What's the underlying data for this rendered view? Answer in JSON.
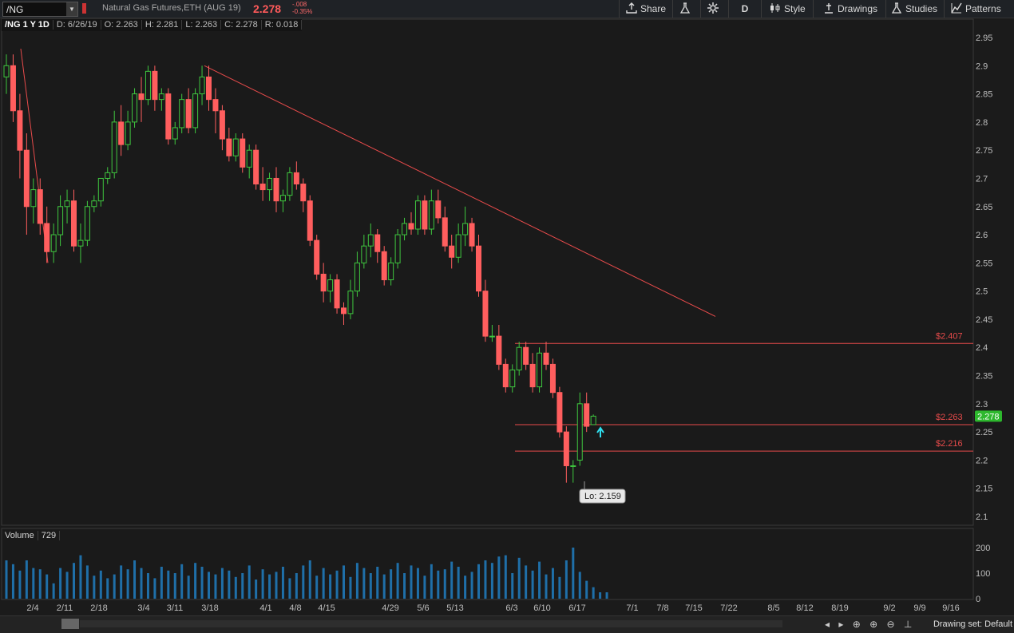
{
  "toolbar": {
    "symbol": "/NG",
    "description": "Natural Gas Futures,ETH (AUG 19)",
    "last_price": "2.278",
    "change": "-.008",
    "change_pct": "-0.35%",
    "share_label": "Share",
    "period_label": "D",
    "style_label": "Style",
    "drawings_label": "Drawings",
    "studies_label": "Studies",
    "patterns_label": "Patterns"
  },
  "info": {
    "symbol_period": "/NG 1 Y 1D",
    "date": "D: 6/26/19",
    "open": "O: 2.263",
    "high": "H: 2.281",
    "low": "L: 2.263",
    "close": "C: 2.278",
    "range": "R: 0.018"
  },
  "volume_panel": {
    "label": "Volume",
    "value": "729"
  },
  "price_lines": [
    {
      "label": "$2.407",
      "price": 2.407
    },
    {
      "label": "$2.263",
      "price": 2.263
    },
    {
      "label": "$2.216",
      "price": 2.216
    }
  ],
  "current_price_badge": "2.278",
  "low_callout": "Lo: 2.159",
  "bottom": {
    "drawing_set": "Drawing set: Default"
  },
  "colors": {
    "up": "#3fc73f",
    "down": "#ff5e5e",
    "volume": "#1f6fa8",
    "trendline": "#e84b4b",
    "badge": "#2db82d"
  },
  "chart_data": {
    "type": "candlestick",
    "price_axis": {
      "min": 2.1,
      "max": 2.95,
      "ticks": [
        2.95,
        2.9,
        2.85,
        2.8,
        2.75,
        2.7,
        2.65,
        2.6,
        2.55,
        2.5,
        2.45,
        2.4,
        2.35,
        2.3,
        2.25,
        2.2,
        2.15,
        2.1
      ]
    },
    "volume_axis": {
      "max": 200,
      "ticks": [
        200,
        100,
        0
      ]
    },
    "x_tick_labels": [
      "2/4",
      "2/11",
      "2/18",
      "3/4",
      "3/11",
      "3/18",
      "4/1",
      "4/8",
      "4/15",
      "4/29",
      "5/6",
      "5/13",
      "6/3",
      "6/10",
      "6/17",
      "7/1",
      "7/8",
      "7/15",
      "7/22",
      "8/5",
      "8/12",
      "8/19",
      "9/2",
      "9/9",
      "9/16"
    ],
    "trendlines": [
      {
        "from": [
          "start",
          2.93
        ],
        "to": [
          "2/11",
          2.55
        ]
      },
      {
        "from": [
          "3/18",
          2.9
        ],
        "to": [
          "7/22",
          2.455
        ]
      }
    ],
    "candles": [
      [
        2.88,
        2.92,
        2.85,
        2.9
      ],
      [
        2.9,
        2.92,
        2.8,
        2.82
      ],
      [
        2.82,
        2.85,
        2.7,
        2.75
      ],
      [
        2.75,
        2.78,
        2.6,
        2.65
      ],
      [
        2.65,
        2.7,
        2.62,
        2.68
      ],
      [
        2.68,
        2.7,
        2.6,
        2.62
      ],
      [
        2.62,
        2.65,
        2.55,
        2.57
      ],
      [
        2.57,
        2.62,
        2.55,
        2.6
      ],
      [
        2.6,
        2.67,
        2.58,
        2.65
      ],
      [
        2.65,
        2.68,
        2.62,
        2.66
      ],
      [
        2.66,
        2.68,
        2.57,
        2.58
      ],
      [
        2.58,
        2.62,
        2.55,
        2.59
      ],
      [
        2.59,
        2.66,
        2.58,
        2.65
      ],
      [
        2.65,
        2.67,
        2.64,
        2.66
      ],
      [
        2.66,
        2.7,
        2.65,
        2.7
      ],
      [
        2.7,
        2.72,
        2.69,
        2.71
      ],
      [
        2.71,
        2.82,
        2.7,
        2.8
      ],
      [
        2.8,
        2.83,
        2.74,
        2.76
      ],
      [
        2.76,
        2.82,
        2.75,
        2.8
      ],
      [
        2.8,
        2.86,
        2.79,
        2.85
      ],
      [
        2.85,
        2.88,
        2.8,
        2.84
      ],
      [
        2.84,
        2.9,
        2.83,
        2.89
      ],
      [
        2.89,
        2.9,
        2.82,
        2.84
      ],
      [
        2.84,
        2.86,
        2.82,
        2.85
      ],
      [
        2.85,
        2.86,
        2.76,
        2.77
      ],
      [
        2.77,
        2.8,
        2.76,
        2.79
      ],
      [
        2.79,
        2.85,
        2.78,
        2.84
      ],
      [
        2.84,
        2.86,
        2.78,
        2.79
      ],
      [
        2.79,
        2.86,
        2.78,
        2.85
      ],
      [
        2.85,
        2.9,
        2.83,
        2.88
      ],
      [
        2.88,
        2.9,
        2.82,
        2.84
      ],
      [
        2.84,
        2.86,
        2.78,
        2.82
      ],
      [
        2.82,
        2.83,
        2.75,
        2.77
      ],
      [
        2.77,
        2.79,
        2.73,
        2.74
      ],
      [
        2.74,
        2.78,
        2.73,
        2.77
      ],
      [
        2.77,
        2.78,
        2.71,
        2.72
      ],
      [
        2.72,
        2.76,
        2.7,
        2.75
      ],
      [
        2.75,
        2.76,
        2.68,
        2.69
      ],
      [
        2.69,
        2.72,
        2.66,
        2.68
      ],
      [
        2.68,
        2.71,
        2.66,
        2.7
      ],
      [
        2.7,
        2.72,
        2.64,
        2.66
      ],
      [
        2.66,
        2.68,
        2.64,
        2.67
      ],
      [
        2.67,
        2.72,
        2.66,
        2.71
      ],
      [
        2.71,
        2.73,
        2.68,
        2.69
      ],
      [
        2.69,
        2.7,
        2.64,
        2.66
      ],
      [
        2.66,
        2.67,
        2.58,
        2.59
      ],
      [
        2.59,
        2.6,
        2.52,
        2.53
      ],
      [
        2.53,
        2.55,
        2.48,
        2.5
      ],
      [
        2.5,
        2.53,
        2.48,
        2.52
      ],
      [
        2.52,
        2.53,
        2.46,
        2.47
      ],
      [
        2.47,
        2.48,
        2.44,
        2.46
      ],
      [
        2.46,
        2.52,
        2.45,
        2.5
      ],
      [
        2.5,
        2.57,
        2.49,
        2.55
      ],
      [
        2.55,
        2.6,
        2.54,
        2.58
      ],
      [
        2.58,
        2.62,
        2.56,
        2.6
      ],
      [
        2.6,
        2.61,
        2.55,
        2.57
      ],
      [
        2.57,
        2.58,
        2.51,
        2.52
      ],
      [
        2.52,
        2.56,
        2.51,
        2.55
      ],
      [
        2.55,
        2.61,
        2.54,
        2.6
      ],
      [
        2.6,
        2.63,
        2.59,
        2.62
      ],
      [
        2.62,
        2.64,
        2.6,
        2.61
      ],
      [
        2.61,
        2.67,
        2.6,
        2.66
      ],
      [
        2.66,
        2.67,
        2.6,
        2.61
      ],
      [
        2.61,
        2.68,
        2.6,
        2.66
      ],
      [
        2.66,
        2.68,
        2.62,
        2.63
      ],
      [
        2.63,
        2.65,
        2.57,
        2.58
      ],
      [
        2.58,
        2.6,
        2.54,
        2.56
      ],
      [
        2.56,
        2.62,
        2.55,
        2.6
      ],
      [
        2.6,
        2.65,
        2.58,
        2.62
      ],
      [
        2.62,
        2.63,
        2.57,
        2.58
      ],
      [
        2.58,
        2.6,
        2.49,
        2.5
      ],
      [
        2.5,
        2.52,
        2.41,
        2.42
      ],
      [
        2.42,
        2.44,
        2.41,
        2.42
      ],
      [
        2.42,
        2.44,
        2.36,
        2.37
      ],
      [
        2.37,
        2.38,
        2.32,
        2.33
      ],
      [
        2.33,
        2.37,
        2.32,
        2.36
      ],
      [
        2.36,
        2.41,
        2.35,
        2.4
      ],
      [
        2.4,
        2.41,
        2.36,
        2.37
      ],
      [
        2.37,
        2.39,
        2.32,
        2.33
      ],
      [
        2.33,
        2.4,
        2.32,
        2.39
      ],
      [
        2.39,
        2.41,
        2.36,
        2.37
      ],
      [
        2.37,
        2.38,
        2.31,
        2.32
      ],
      [
        2.32,
        2.33,
        2.24,
        2.25
      ],
      [
        2.25,
        2.26,
        2.16,
        2.19
      ],
      [
        2.19,
        2.2,
        2.16,
        2.19
      ],
      [
        2.2,
        2.32,
        2.19,
        2.3
      ],
      [
        2.3,
        2.32,
        2.25,
        2.26
      ],
      [
        2.263,
        2.281,
        2.263,
        2.278
      ]
    ],
    "volumes": [
      150,
      135,
      110,
      150,
      120,
      115,
      95,
      60,
      120,
      105,
      140,
      170,
      130,
      90,
      110,
      80,
      95,
      130,
      115,
      150,
      120,
      100,
      80,
      125,
      110,
      100,
      135,
      90,
      140,
      125,
      105,
      95,
      120,
      110,
      85,
      100,
      130,
      75,
      115,
      95,
      105,
      125,
      80,
      100,
      130,
      150,
      90,
      120,
      95,
      110,
      130,
      85,
      140,
      120,
      100,
      125,
      95,
      115,
      140,
      100,
      130,
      120,
      90,
      135,
      110,
      115,
      145,
      125,
      90,
      105,
      135,
      150,
      140,
      165,
      170,
      100,
      160,
      130,
      110,
      145,
      95,
      120,
      85,
      150,
      200,
      105,
      70,
      45,
      25,
      25
    ]
  }
}
